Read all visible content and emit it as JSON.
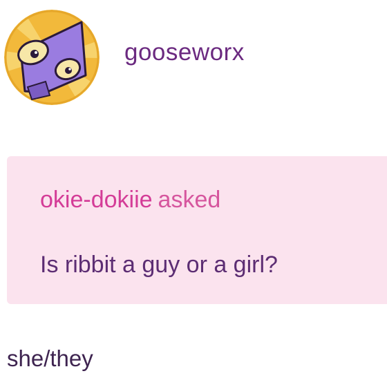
{
  "post": {
    "blog_name": "gooseworx",
    "avatar_icon": "frog-character-avatar-icon",
    "ask": {
      "asker": "okie-dokiie",
      "asked_word": "asked",
      "question": "Is ribbit a guy or a girl?"
    },
    "answer": "she/they"
  },
  "colors": {
    "blog_name": "#6b2a80",
    "ask_background": "#fbe3ee",
    "asker_name": "#d43c97",
    "question_text": "#5c2d73",
    "avatar_background": "#f2b93b",
    "avatar_character": "#9a7ce0"
  }
}
